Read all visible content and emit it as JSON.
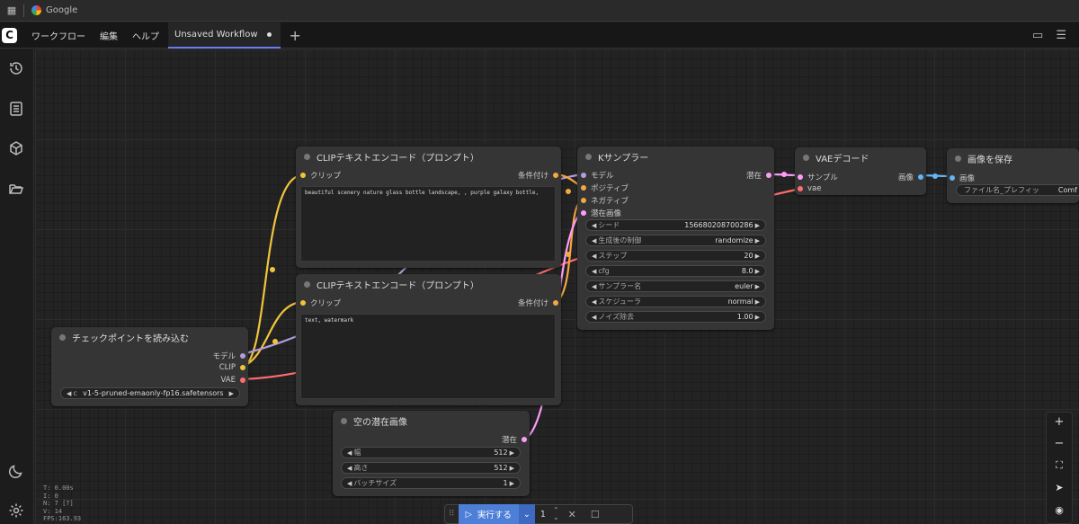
{
  "browser": {
    "tab_title": "Google"
  },
  "menu": {
    "workflow": "ワークフロー",
    "edit": "編集",
    "help": "ヘルプ",
    "tab_title": "Unsaved Workflow",
    "add": "+"
  },
  "nodes": {
    "clip1": {
      "title": "CLIPテキストエンコード（プロンプト）",
      "in_clip": "クリップ",
      "out": "条件付け",
      "text": "beautiful scenery nature glass bottle landscape, , purple galaxy bottle,"
    },
    "clip2": {
      "title": "CLIPテキストエンコード（プロンプト）",
      "in_clip": "クリップ",
      "out": "条件付け",
      "text": "text, watermark"
    },
    "ksampler": {
      "title": "Kサンプラー",
      "in_model": "モデル",
      "in_pos": "ポジティブ",
      "in_neg": "ネガティブ",
      "in_latent": "潜在画像",
      "out": "潜在",
      "w": [
        {
          "label": "シード",
          "value": "156680208700286"
        },
        {
          "label": "生成後の制御",
          "value": "randomize"
        },
        {
          "label": "ステップ",
          "value": "20"
        },
        {
          "label": "cfg",
          "value": "8.0"
        },
        {
          "label": "サンプラー名",
          "value": "euler"
        },
        {
          "label": "スケジューラ",
          "value": "normal"
        },
        {
          "label": "ノイズ除去",
          "value": "1.00"
        }
      ]
    },
    "vae": {
      "title": "VAEデコード",
      "in_samples": "サンプル",
      "in_vae": "vae",
      "out": "画像"
    },
    "save": {
      "title": "画像を保存",
      "in_images": "画像",
      "w_label": "ファイル名_プレフィッ",
      "w_value": "Comf"
    },
    "checkpoint": {
      "title": "チェックポイントを読み込む",
      "out_model": "モデル",
      "out_clip": "CLIP",
      "out_vae": "VAE",
      "w_label": "c",
      "w_value": "v1-5-pruned-emaonly-fp16.safetensors"
    },
    "latent": {
      "title": "空の潜在画像",
      "out": "潜在",
      "w": [
        {
          "label": "幅",
          "value": "512"
        },
        {
          "label": "高さ",
          "value": "512"
        },
        {
          "label": "バッチサイズ",
          "value": "1"
        }
      ]
    }
  },
  "run": {
    "label": "実行する",
    "count": "1"
  },
  "stats": {
    "t": "T: 0.00s",
    "i": "I: 0",
    "n": "N: 7 [7]",
    "v": "V: 14",
    "fps": "FPS:163.93"
  },
  "colors": {
    "clip": "#f0c43c",
    "model": "#b39ddb",
    "vae": "#ff6e6e",
    "cond": "#f5a742",
    "latent": "#ff9cf9",
    "image": "#64b5f6",
    "accent": "#4e7fd8"
  }
}
